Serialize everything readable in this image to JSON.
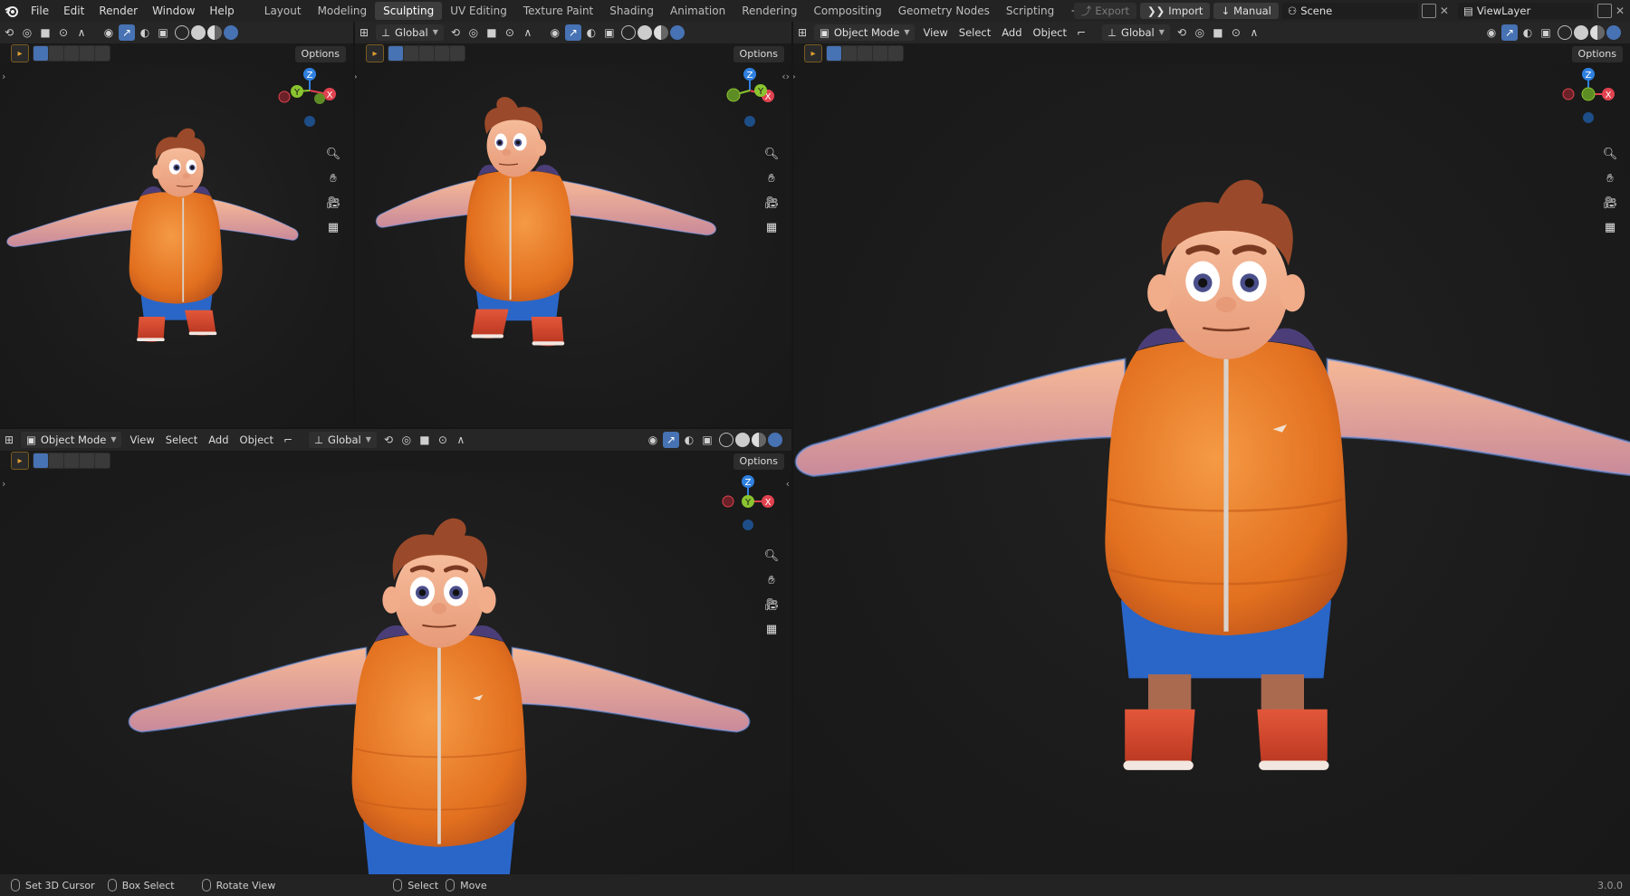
{
  "menu": [
    "File",
    "Edit",
    "Render",
    "Window",
    "Help"
  ],
  "workspaces": [
    "Layout",
    "Modeling",
    "Sculpting",
    "UV Editing",
    "Texture Paint",
    "Shading",
    "Animation",
    "Rendering",
    "Compositing",
    "Geometry Nodes",
    "Scripting"
  ],
  "active_workspace": "Sculpting",
  "add_tab": "+",
  "topright": {
    "export": "Export",
    "import": "Import",
    "manual": "Manual",
    "scene": "Scene",
    "view_layer": "ViewLayer"
  },
  "viewport_header": {
    "mode": "Object Mode",
    "view": "View",
    "select": "Select",
    "add": "Add",
    "object": "Object",
    "orientation": "Global",
    "options": "Options"
  },
  "gizmo": {
    "z": "Z",
    "y": "Y",
    "x": "X"
  },
  "status": {
    "cursor": "Set 3D Cursor",
    "box": "Box Select",
    "rotate": "Rotate View",
    "select": "Select",
    "move": "Move",
    "version": "3.0.0"
  },
  "colors": {
    "accent": "#4772b3",
    "x_axis": "#e0424f",
    "y_axis": "#8ac42f",
    "z_axis": "#2f80e0",
    "vest": "#ee7f2a",
    "shorts": "#2a66c8",
    "skin": "#f1ac8a",
    "hair": "#9a4a2a",
    "shoes": "#d9452b"
  }
}
